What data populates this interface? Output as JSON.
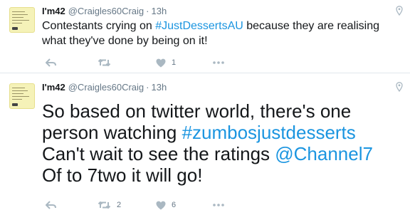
{
  "tweets": [
    {
      "name": "I'm42",
      "handle": "@Craigles60Craig",
      "separator": "·",
      "time": "13h",
      "text": {
        "before": "Contestants crying on ",
        "hashtag": "#JustDessertsAU",
        "after": " because they are realising what they've done by being on it!"
      },
      "retweet_count": "",
      "like_count": "1"
    },
    {
      "name": "I'm42",
      "handle": "@Craigles60Craig",
      "separator": "·",
      "time": "13h",
      "text": {
        "line1": "So based on twitter world, there's one person watching ",
        "hashtag": "#zumbosjustdesserts",
        "line2": "Can't wait to see the ratings ",
        "mention": "@Channel7",
        "line3": "Of to 7two it will go!"
      },
      "retweet_count": "2",
      "like_count": "6"
    }
  ],
  "colors": {
    "link": "#1b95e0",
    "icon": "#aab8c2",
    "secondary_text": "#657786",
    "avatar_bg": "#f5f2b8"
  },
  "icons": [
    "avatar",
    "geo-pin-icon",
    "reply-icon",
    "retweet-icon",
    "heart-icon",
    "more-icon"
  ]
}
